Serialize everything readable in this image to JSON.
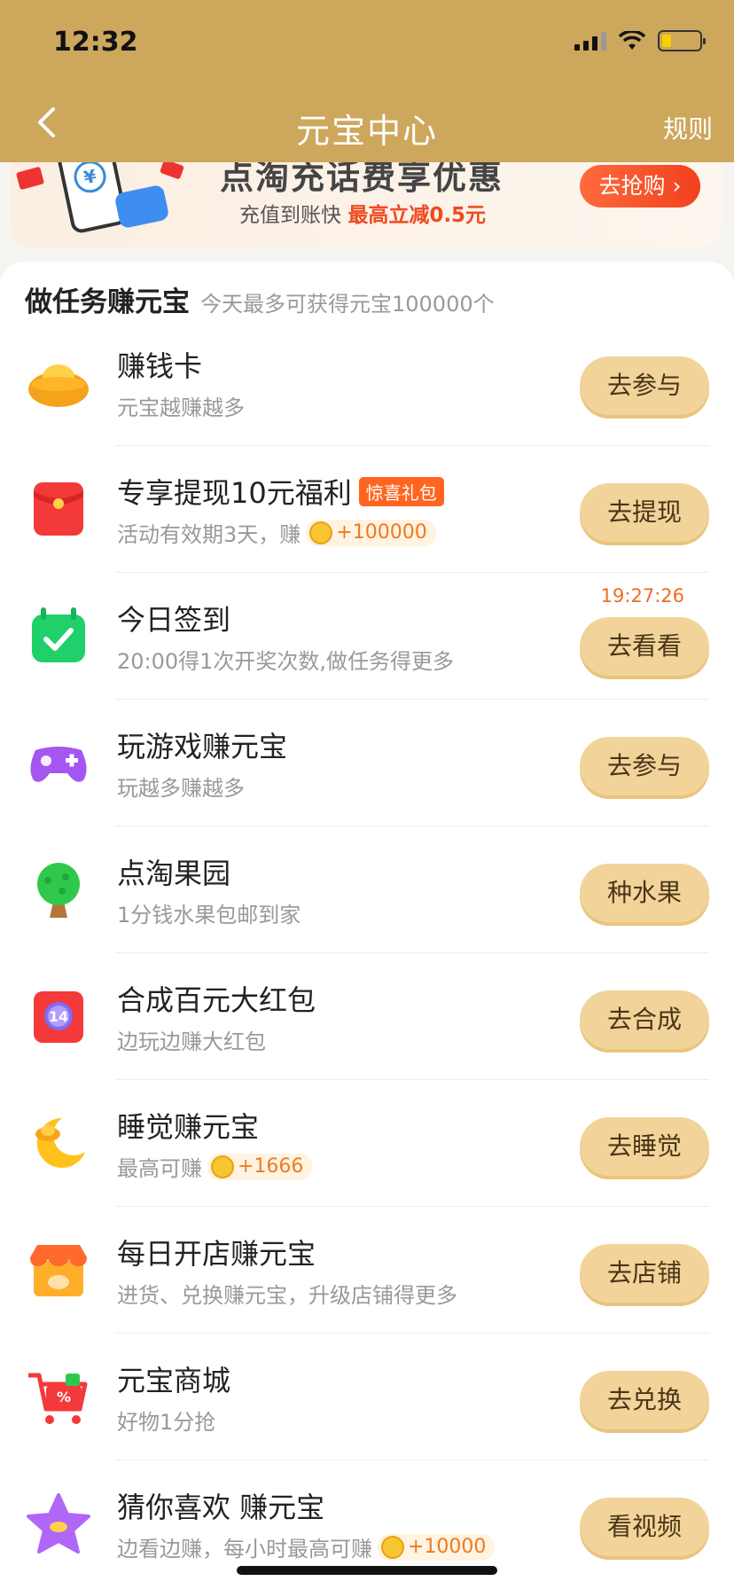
{
  "status_bar": {
    "time": "12:32"
  },
  "nav": {
    "title": "元宝中心",
    "rules": "规则"
  },
  "banner": {
    "headline": "点淘充话费享优惠",
    "sub_prefix": "充值到账快",
    "sub_highlight": "最高立减0.5元",
    "button": "去抢购 ›"
  },
  "section": {
    "title": "做任务赚元宝",
    "subtitle": "今天最多可获得元宝100000个"
  },
  "tasks": [
    {
      "title": "赚钱卡",
      "desc": "元宝越赚越多",
      "button": "去参与"
    },
    {
      "title": "专享提现10元福利",
      "tag": "惊喜礼包",
      "desc": "活动有效期3天，赚",
      "coin": "+100000",
      "button": "去提现"
    },
    {
      "title": "今日签到",
      "desc": "20:00得1次开奖次数,做任务得更多",
      "countdown": "19:27:26",
      "button": "去看看"
    },
    {
      "title": "玩游戏赚元宝",
      "desc": "玩越多赚越多",
      "button": "去参与"
    },
    {
      "title": "点淘果园",
      "desc": "1分钱水果包邮到家",
      "button": "种水果"
    },
    {
      "title": "合成百元大红包",
      "desc": "边玩边赚大红包",
      "button": "去合成",
      "icon_text": "14"
    },
    {
      "title": "睡觉赚元宝",
      "desc": "最高可赚",
      "coin": "+1666",
      "button": "去睡觉"
    },
    {
      "title": "每日开店赚元宝",
      "desc": "进货、兑换赚元宝，升级店铺得更多",
      "button": "去店铺"
    },
    {
      "title": "元宝商城",
      "desc": "好物1分抢",
      "button": "去兑换"
    },
    {
      "title": "猜你喜欢 赚元宝",
      "desc": "边看边赚，每小时最高可赚",
      "coin": "+10000",
      "button": "看视频"
    }
  ],
  "colors": {
    "header": "#cda75c",
    "button": "#f2d49a",
    "accent": "#f04a1e"
  }
}
